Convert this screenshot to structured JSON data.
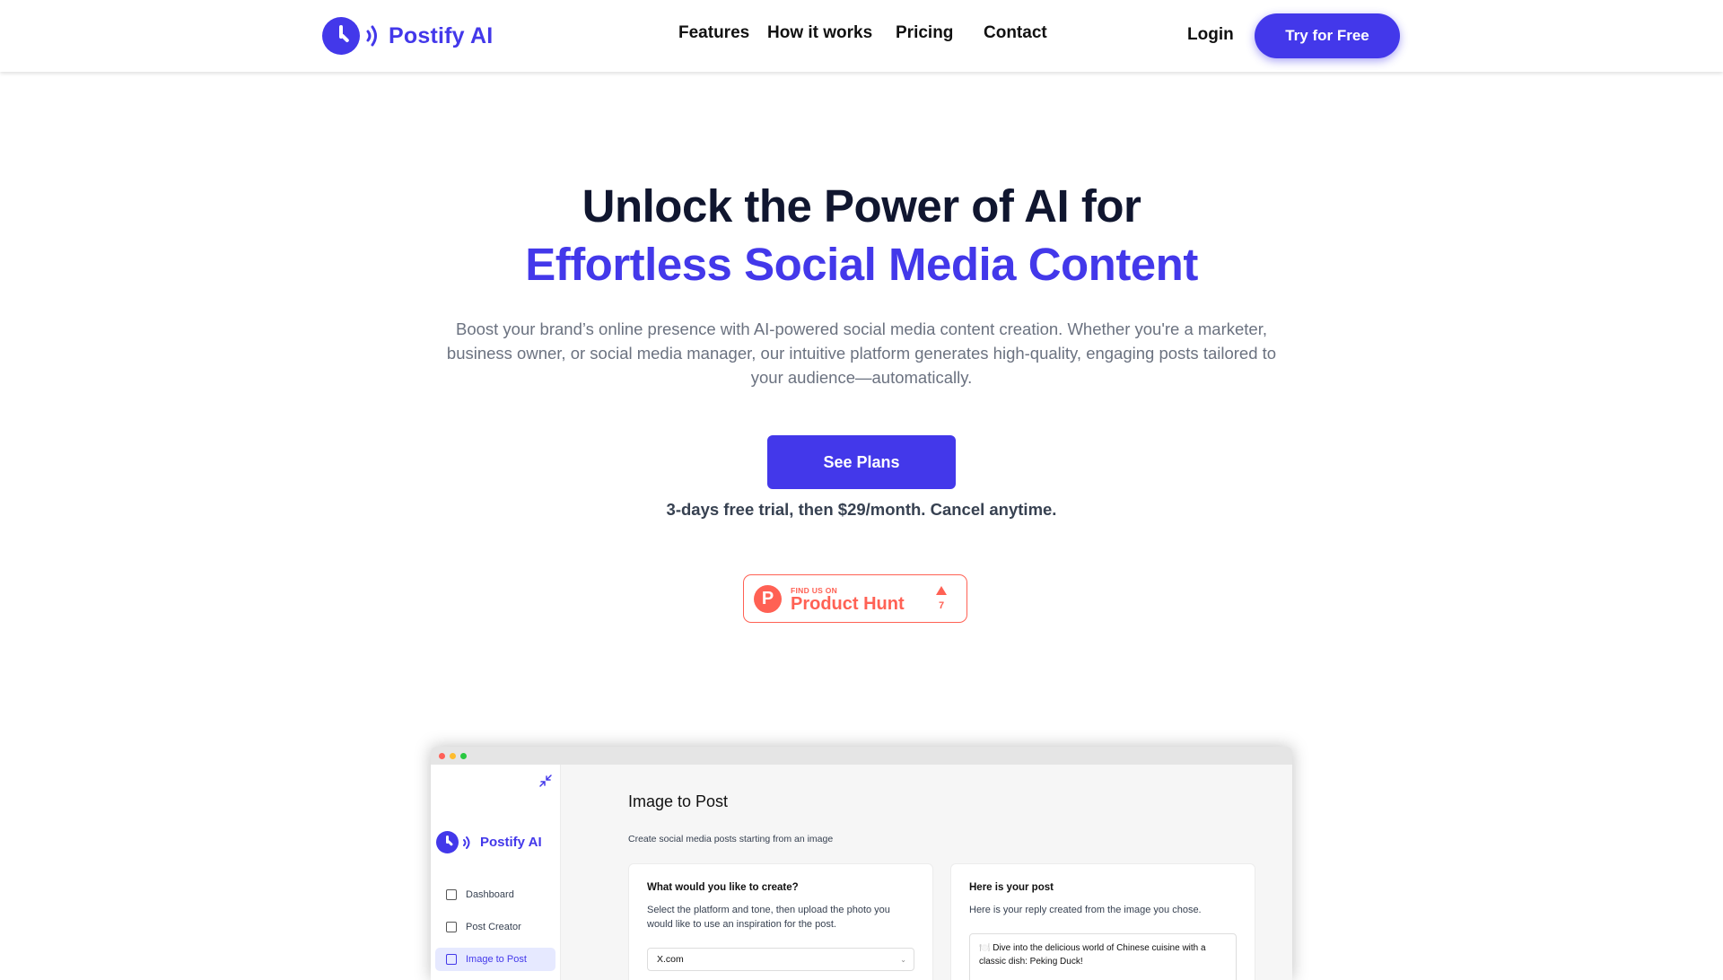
{
  "brand": {
    "name": "Postify AI",
    "accent": "#4338ea"
  },
  "nav": {
    "items": [
      "Features",
      "How it works",
      "Pricing",
      "Contact"
    ],
    "login": "Login",
    "cta": "Try for Free"
  },
  "hero": {
    "title_line1": "Unlock the Power of AI for",
    "title_line2": "Effortless Social Media Content",
    "subtitle": "Boost your brand’s online presence with AI-powered social media content creation. Whether you're a marketer, business owner, or social media manager, our intuitive platform generates high-quality, engaging posts tailored to your audience—automatically.",
    "cta": "See Plans",
    "trial_note": "3-days free trial, then $29/month. Cancel anytime."
  },
  "product_hunt": {
    "small": "FIND US ON",
    "big": "Product Hunt",
    "upvotes": "7",
    "color": "#ff6154"
  },
  "app_preview": {
    "sidebar": {
      "brand": "Postify AI",
      "items": [
        {
          "label": "Dashboard",
          "icon": "dashboard-icon"
        },
        {
          "label": "Post Creator",
          "icon": "post-creator-icon"
        },
        {
          "label": "Image to Post",
          "icon": "image-icon",
          "active": true
        }
      ]
    },
    "main": {
      "title": "Image to Post",
      "subtitle": "Create social media posts starting from an image",
      "left_card": {
        "heading": "What would you like to create?",
        "text": "Select the platform and tone, then upload the photo you would like to use an inspiration for the post.",
        "platform": "X.com"
      },
      "right_card": {
        "heading": "Here is your post",
        "text": "Here is your reply created from the image you chose.",
        "reply": "🍽️ Dive into the delicious world of Chinese cuisine with a classic dish: Peking Duck!"
      }
    }
  }
}
